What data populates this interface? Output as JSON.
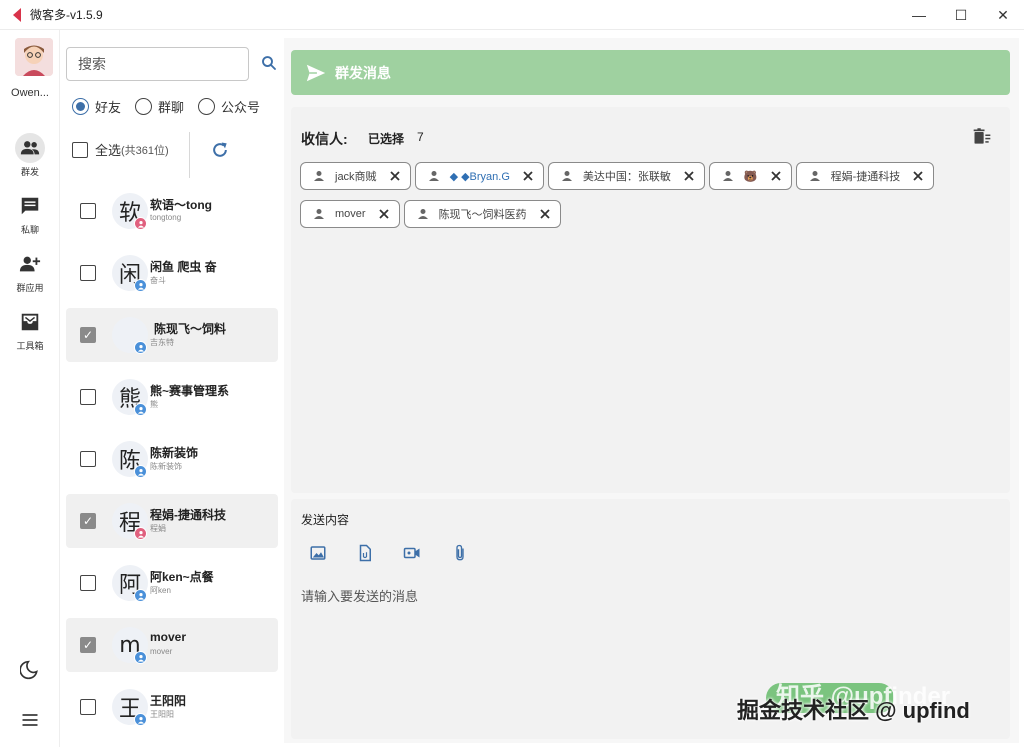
{
  "window": {
    "title": "微客多-v1.5.9",
    "controls": {
      "minimize": "—",
      "maximize": "☐",
      "close": "✕"
    }
  },
  "nav": {
    "user_name": "Owen...",
    "items": [
      {
        "label": "群发",
        "icon": "group-icon",
        "active": true
      },
      {
        "label": "私聊",
        "icon": "chat-icon",
        "active": false
      },
      {
        "label": "群应用",
        "icon": "add-user-icon",
        "active": false
      },
      {
        "label": "工具箱",
        "icon": "inbox-icon",
        "active": false
      }
    ],
    "bottom_icons": [
      "moon-icon",
      "menu-icon"
    ]
  },
  "contacts_panel": {
    "search_placeholder": "搜索",
    "filters": [
      {
        "label": "好友",
        "selected": true
      },
      {
        "label": "群聊",
        "selected": false
      },
      {
        "label": "公众号",
        "selected": false
      }
    ],
    "select_all_label": "全选",
    "select_all_count": "(共361位)",
    "contacts": [
      {
        "avatar_char": "软",
        "name": "软语～tong",
        "sub": "tongtong",
        "checked": false,
        "badge": "pink"
      },
      {
        "avatar_char": "闲",
        "name": "闲鱼 爬虫 奋",
        "sub": "奋斗",
        "checked": false,
        "badge": "blue"
      },
      {
        "avatar_char": "",
        "name": "陈现飞～饲料",
        "sub": "吉东特",
        "checked": true,
        "badge": "blue"
      },
      {
        "avatar_char": "熊",
        "name": "熊~赛事管理系",
        "sub": "熊",
        "checked": false,
        "badge": "blue"
      },
      {
        "avatar_char": "陈",
        "name": "陈新装饰",
        "sub": "陈新装饰",
        "checked": false,
        "badge": "blue"
      },
      {
        "avatar_char": "程",
        "name": "程娟-捷通科技",
        "sub": "程娟",
        "checked": true,
        "badge": "pink"
      },
      {
        "avatar_char": "阿",
        "name": "阿ken~点餐",
        "sub": "阿ken",
        "checked": false,
        "badge": "blue"
      },
      {
        "avatar_char": "m",
        "name": "mover",
        "sub": "mover",
        "checked": true,
        "badge": "blue"
      },
      {
        "avatar_char": "王",
        "name": "王阳阳",
        "sub": "王阳阳",
        "checked": false,
        "badge": "blue"
      }
    ]
  },
  "main": {
    "header_title": "群发消息",
    "recipients_label": "收信人:",
    "selected_label": "已选择",
    "selected_count": "7",
    "recipients": [
      "jack商贼",
      "◆ ◆Bryan.G",
      "美达中国：张联敏",
      "🐻",
      "程娟-捷通科技",
      "mover",
      "陈现飞～饲料医药"
    ],
    "compose_label": "发送内容",
    "compose_tools": [
      "image-icon",
      "file-icon",
      "video-icon",
      "attachment-icon"
    ],
    "compose_placeholder": "请输入要发送的消息"
  },
  "watermark": {
    "faint": "知乎 @upfinder",
    "text": "掘金技术社区 @ upfind"
  },
  "colors": {
    "accent_green": "#9fd1a0",
    "radio_blue": "#3d6fa8",
    "badge_blue": "#4a90d9",
    "badge_pink": "#e0607e"
  }
}
